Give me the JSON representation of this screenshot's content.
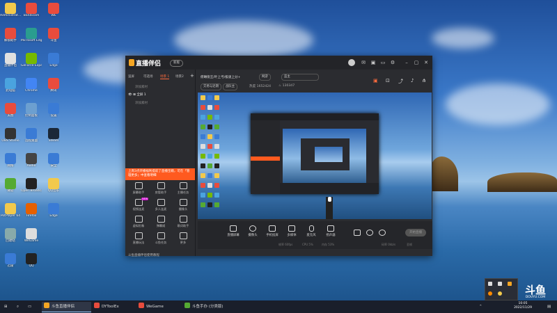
{
  "desktop": {
    "icons": [
      {
        "label": "Administrat...",
        "color": "#f2c94c"
      },
      {
        "label": "解锁助手",
        "color": "#e84c3d"
      },
      {
        "label": "直播伴侣",
        "color": "#e0e0e0"
      },
      {
        "label": "此电脑",
        "color": "#4aa3df"
      },
      {
        "label": "美图",
        "color": "#e84c3d"
      },
      {
        "label": "OBS Studio",
        "color": "#333333"
      },
      {
        "label": "网络",
        "color": "#3a7bd5"
      },
      {
        "label": "微软",
        "color": "#55aa33"
      },
      {
        "label": "PotPlayer 64",
        "color": "#f2c94c"
      },
      {
        "label": "回收站",
        "color": "#8aa"
      },
      {
        "label": "迅雷",
        "color": "#3a7bd5"
      },
      {
        "label": "Bandicam",
        "color": "#e84c3d"
      },
      {
        "label": "Microsoft Edge",
        "color": "#2a9d8f"
      },
      {
        "label": "GeForce Experience",
        "color": "#76b900"
      },
      {
        "label": "Chrome",
        "color": "#4285f4"
      },
      {
        "label": "控制面板",
        "color": "#6c9fd0"
      },
      {
        "label": "远程桌面",
        "color": "#3a7bd5"
      },
      {
        "label": "Audio",
        "color": "#444"
      },
      {
        "label": "Open Broadcas...",
        "color": "#222"
      },
      {
        "label": "Firefox",
        "color": "#e66000"
      },
      {
        "label": "WeGame",
        "color": "#ddd"
      },
      {
        "label": "QQ",
        "color": "#222"
      },
      {
        "label": "WE",
        "color": "#e84c3d"
      },
      {
        "label": "斗鱼",
        "color": "#e84c3d"
      },
      {
        "label": "Edge",
        "color": "#3a7bd5"
      },
      {
        "label": "腾讯",
        "color": "#e84c3d"
      },
      {
        "label": "设置",
        "color": "#3a7bd5"
      },
      {
        "label": "Steam",
        "color": "#1b2838"
      },
      {
        "label": "安全",
        "color": "#3a7bd5"
      },
      {
        "label": "QQ音乐",
        "color": "#f2c94c"
      },
      {
        "label": "Edge",
        "color": "#3a7bd5"
      }
    ]
  },
  "app": {
    "title": "直播伴侣",
    "version": "新版",
    "scene_tabs": [
      "竖屏",
      "可选场",
      "场景 1",
      "场景2"
    ],
    "source_rows": [
      "添加素材",
      "全屏 1",
      "添加素材"
    ],
    "promo_text": "上周3点开播福利提前了直播宝箱，可在「管理更多」中查看明细",
    "tools": [
      {
        "label": "屏幕助手"
      },
      {
        "label": "房管助手"
      },
      {
        "label": "主播任务"
      },
      {
        "label": "视频连麦",
        "badge": "NEW"
      },
      {
        "label": "多人连麦"
      },
      {
        "label": "摄像头"
      },
      {
        "label": "虚拟形象"
      },
      {
        "label": "弹幕姬"
      },
      {
        "label": "歌词助手"
      },
      {
        "label": "直播玩法"
      },
      {
        "label": "斗鱼任务"
      },
      {
        "label": "更多"
      }
    ],
    "bottom_hint": "斗鱼直播伴侣使用教程",
    "info": {
      "room_title": "俯瞰街王/叶上弓/极速上分+",
      "category": "网游",
      "anchor": "蓝主",
      "stats_left": "交易与近期",
      "stats_mid": "战队主",
      "stats_hot": "热度 1652424",
      "fans": "130347"
    },
    "controls": [
      {
        "label": "直播屏幕"
      },
      {
        "label": "摄像头"
      },
      {
        "label": "手机投屏"
      },
      {
        "label": "多媒体"
      },
      {
        "label": "麦克风"
      },
      {
        "label": "扬声器"
      }
    ],
    "start_label": "开始直播",
    "status": {
      "a": "帧率 60fps",
      "b": "CPU 5%",
      "c": "内存 53%",
      "d": "码率 0kb/s",
      "e": "丢帧"
    }
  },
  "taskbar": {
    "items": [
      {
        "label": "斗鱼直播伴侣",
        "color": "#f5a623",
        "active": true
      },
      {
        "label": "DYToolEx",
        "color": "#e84c3d",
        "active": false
      },
      {
        "label": "WeGame",
        "color": "#e84c3d",
        "active": false
      },
      {
        "label": "斗鱼手办 (分类版)",
        "color": "#55aa33",
        "active": false
      }
    ],
    "time": "10:05",
    "date": "2022/11/29"
  },
  "watermark": {
    "big": "斗鱼",
    "small": "DOUYU.COM"
  },
  "colors": {
    "accent": "#ff6b3d",
    "promo": "#ff5a1f"
  }
}
